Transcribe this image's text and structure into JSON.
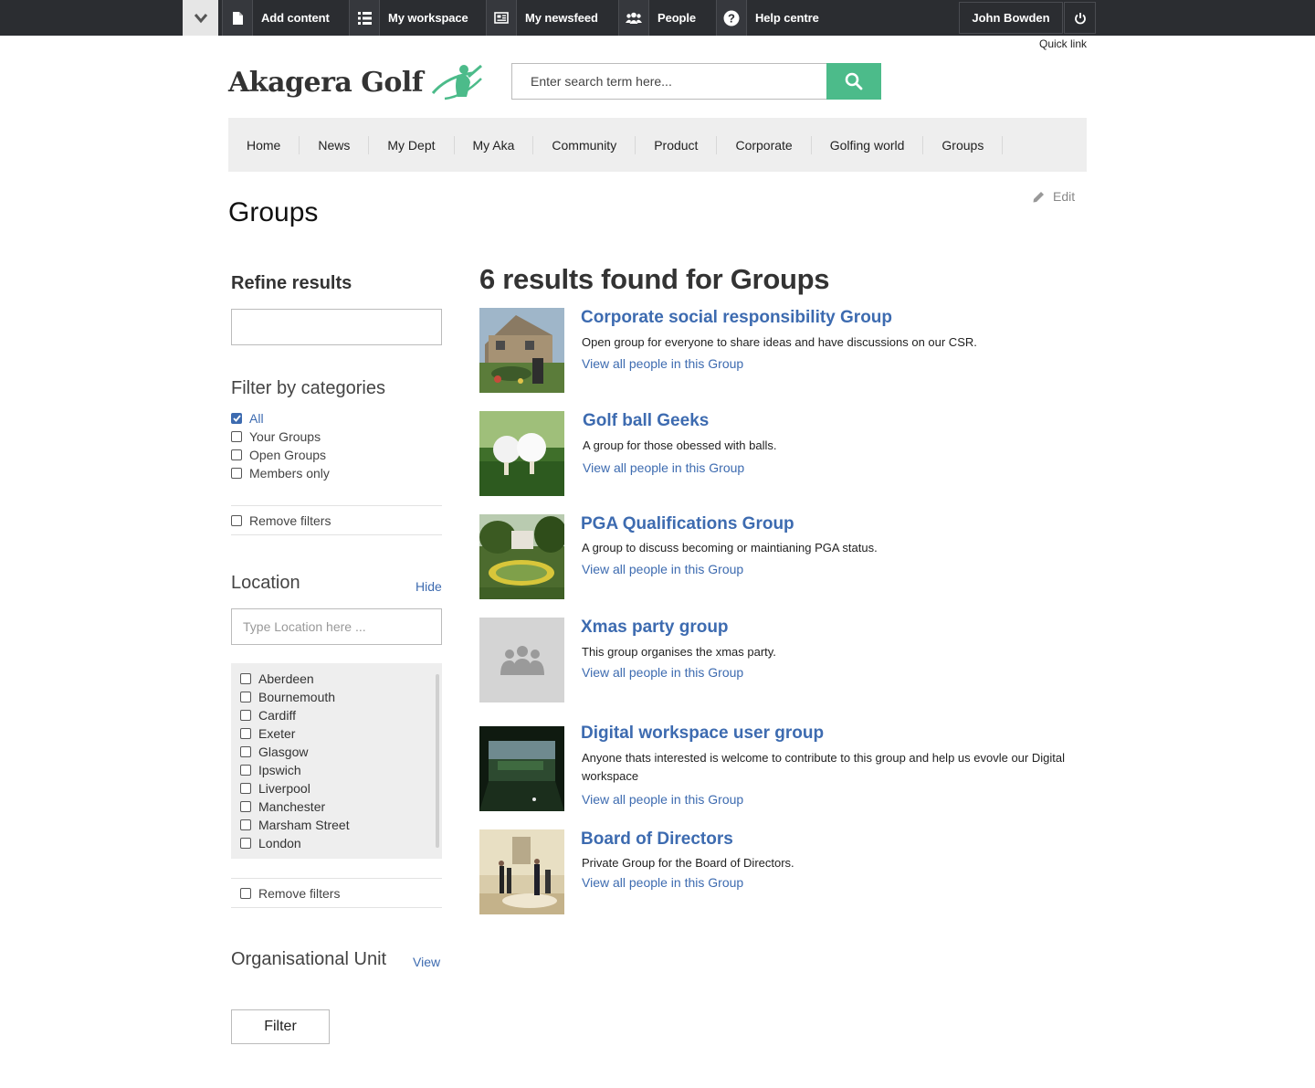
{
  "topbar": {
    "items": [
      {
        "label": "Add content",
        "icon": "file-icon"
      },
      {
        "label": "My workspace",
        "icon": "list-icon"
      },
      {
        "label": "My newsfeed",
        "icon": "newspaper-icon"
      },
      {
        "label": "People",
        "icon": "people-icon"
      },
      {
        "label": "Help centre",
        "icon": "help-icon"
      }
    ],
    "user_name": "John Bowden",
    "quick_link": "Quick link"
  },
  "header": {
    "logo_text": "Akagera Golf",
    "search_placeholder": "Enter search term here..."
  },
  "nav": {
    "items": [
      "Home",
      "News",
      "My Dept",
      "My Aka",
      "Community",
      "Product",
      "Corporate",
      "Golfing world",
      "Groups"
    ]
  },
  "page": {
    "title": "Groups",
    "edit_label": "Edit"
  },
  "sidebar": {
    "refine_title": "Refine results",
    "refine_value": "",
    "filter_title": "Filter by categories",
    "categories": [
      {
        "label": "All",
        "checked": true
      },
      {
        "label": "Your Groups",
        "checked": false
      },
      {
        "label": "Open Groups",
        "checked": false
      },
      {
        "label": "Members only",
        "checked": false
      }
    ],
    "remove_filters": "Remove filters",
    "location_title": "Location",
    "location_toggle": "Hide",
    "location_placeholder": "Type Location here ...",
    "locations": [
      "Aberdeen",
      "Bournemouth",
      "Cardiff",
      "Exeter",
      "Glasgow",
      "Ipswich",
      "Liverpool",
      "Manchester",
      "Marsham Street",
      "London"
    ],
    "org_unit_title": "Organisational Unit",
    "org_unit_toggle": "View",
    "filter_button": "Filter"
  },
  "results": {
    "heading": "6 results found for Groups",
    "view_people_label": "View all people in this Group",
    "items": [
      {
        "title": "Corporate social responsibility Group",
        "description": "Open group for everyone to share ideas and have discussions on our CSR.",
        "link": "View all people in this Group"
      },
      {
        "title": "Golf ball Geeks",
        "description": "A group for those obessed with balls.",
        "link": "View all people in this Group"
      },
      {
        "title": "PGA Qualifications Group",
        "description": "A group to discuss becoming or maintianing PGA status.",
        "link": "View all people in this Group"
      },
      {
        "title": "Xmas party group",
        "description": "This group organises the xmas party.",
        "link": "View all people in this Group"
      },
      {
        "title": "Digital workspace user group",
        "description": "Anyone thats interested is welcome to contribute to this group and help us evovle our Digital workspace",
        "link": "View all people in this Group"
      },
      {
        "title": "Board of Directors",
        "description": "Private Group for the Board of Directors.",
        "link": "View all people in this Group"
      }
    ]
  },
  "colors": {
    "topbar": "#2b2d31",
    "accent_green": "#4cbb8a",
    "link_blue": "#3d6bb0",
    "nav_bg": "#eeeeee"
  }
}
